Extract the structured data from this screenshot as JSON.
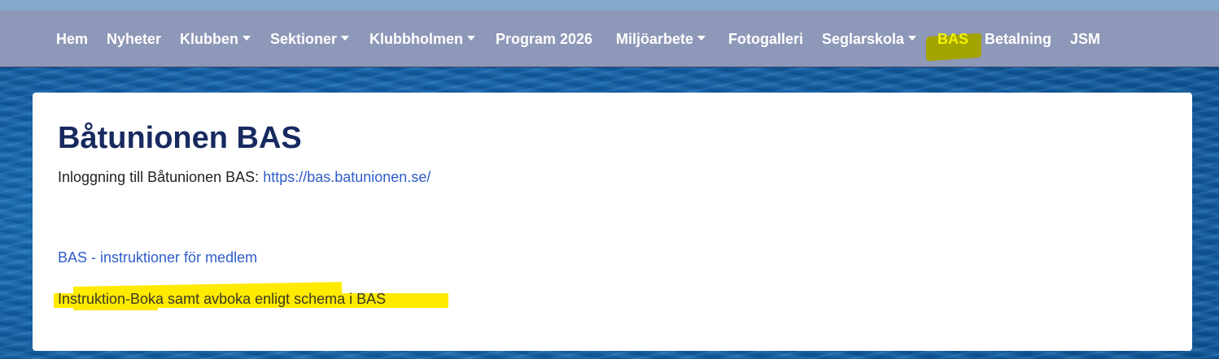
{
  "nav": {
    "items": [
      {
        "label": "Hem",
        "dropdown": false
      },
      {
        "label": "Nyheter",
        "dropdown": false
      },
      {
        "label": "Klubben",
        "dropdown": true
      },
      {
        "label": "Sektioner",
        "dropdown": true
      },
      {
        "label": "Klubbholmen",
        "dropdown": true
      },
      {
        "label": "Program 2026",
        "dropdown": false
      },
      {
        "label": "Miljöarbete",
        "dropdown": true
      },
      {
        "label": "Fotogalleri",
        "dropdown": false
      },
      {
        "label": "Seglarskola",
        "dropdown": true
      },
      {
        "label": "BAS",
        "dropdown": false,
        "highlighted": true
      },
      {
        "label": "Betalning",
        "dropdown": false
      },
      {
        "label": "JSM",
        "dropdown": false
      }
    ]
  },
  "content": {
    "title": "Båtunionen BAS",
    "login_text": "Inloggning till Båtunionen BAS: ",
    "login_url": "https://bas.batunionen.se/",
    "instructions_link": "BAS - instruktioner för medlem",
    "boka_text": "Instruktion-Boka samt avboka enligt schema i BAS"
  },
  "colors": {
    "navbar_bg": "#8e98b8",
    "top_strip": "#82a9c9",
    "title": "#172a5f",
    "link": "#2f5cc9",
    "highlight_yellow": "#ffea00",
    "highlight_olive": "#a3a300"
  }
}
